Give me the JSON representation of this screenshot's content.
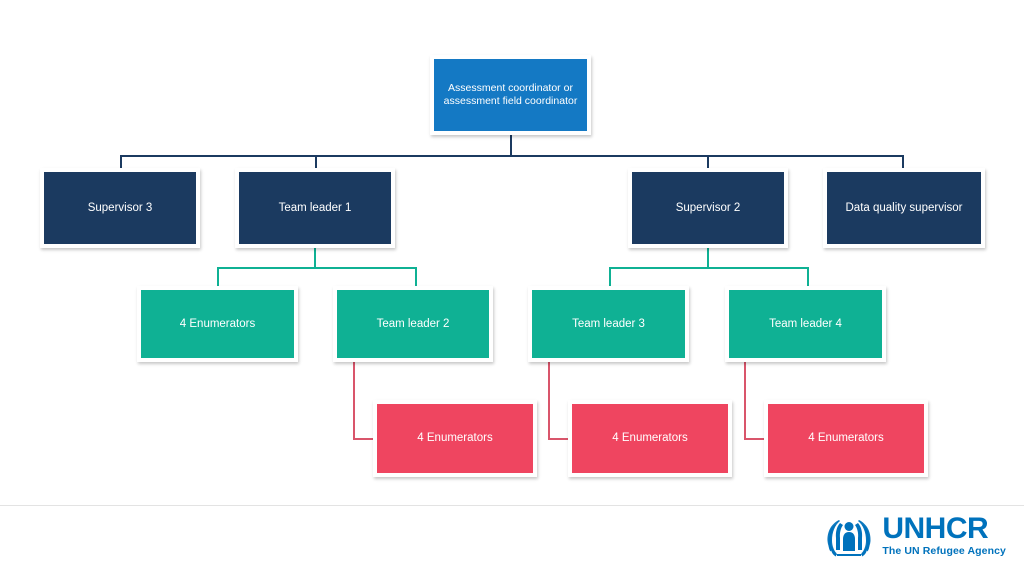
{
  "chart_title": "",
  "colors": {
    "root_box": "#1479c4",
    "level2_box": "#1b3a60",
    "level3_box": "#0fb194",
    "level4_box": "#ef4560",
    "connector_navy": "#1b3a60",
    "connector_teal": "#0fb194",
    "connector_red": "#d9556b",
    "background": "#ffffff",
    "box_border": "#ffffff",
    "footer_rule": "#e3e3e3",
    "logo_blue": "#0072bc"
  },
  "nodes": {
    "root": {
      "label": "Assessment coordinator or\nassessment field coordinator"
    },
    "level2": [
      {
        "label": "Supervisor 3"
      },
      {
        "label": "Team leader 1"
      },
      {
        "label": "Supervisor 2"
      },
      {
        "label": "Data quality supervisor"
      }
    ],
    "level3": [
      {
        "label": "4 Enumerators"
      },
      {
        "label": "Team leader 2"
      },
      {
        "label": "Team leader 3"
      },
      {
        "label": "Team leader 4"
      }
    ],
    "level4": [
      {
        "label": "4 Enumerators"
      },
      {
        "label": "4 Enumerators"
      },
      {
        "label": "4 Enumerators"
      }
    ]
  },
  "footer": {
    "logo_word": "UNHCR",
    "logo_tagline": "The UN Refugee Agency"
  }
}
